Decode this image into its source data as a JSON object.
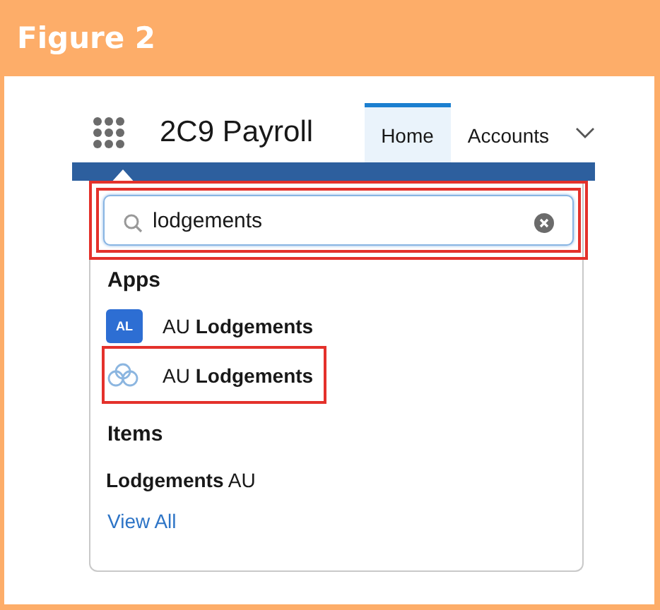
{
  "figure": {
    "title": "Figure 2"
  },
  "nav": {
    "app_name": "2C9 Payroll",
    "tabs": [
      {
        "label": "Home",
        "selected": true
      },
      {
        "label": "Accounts",
        "selected": false
      }
    ]
  },
  "search": {
    "value": "lodgements",
    "highlighted": true
  },
  "sections": [
    {
      "heading": "Apps",
      "results": [
        {
          "kind": "badge",
          "badge_text": "AL",
          "label": "AU **Lodgements**",
          "highlighted": false
        },
        {
          "kind": "cloud",
          "label": "AU **Lodgements**",
          "highlighted": true
        }
      ]
    },
    {
      "heading": "Items",
      "results": [
        {
          "kind": "plain",
          "label": "**Lodgements** AU"
        }
      ]
    }
  ],
  "view_all": "View All"
}
